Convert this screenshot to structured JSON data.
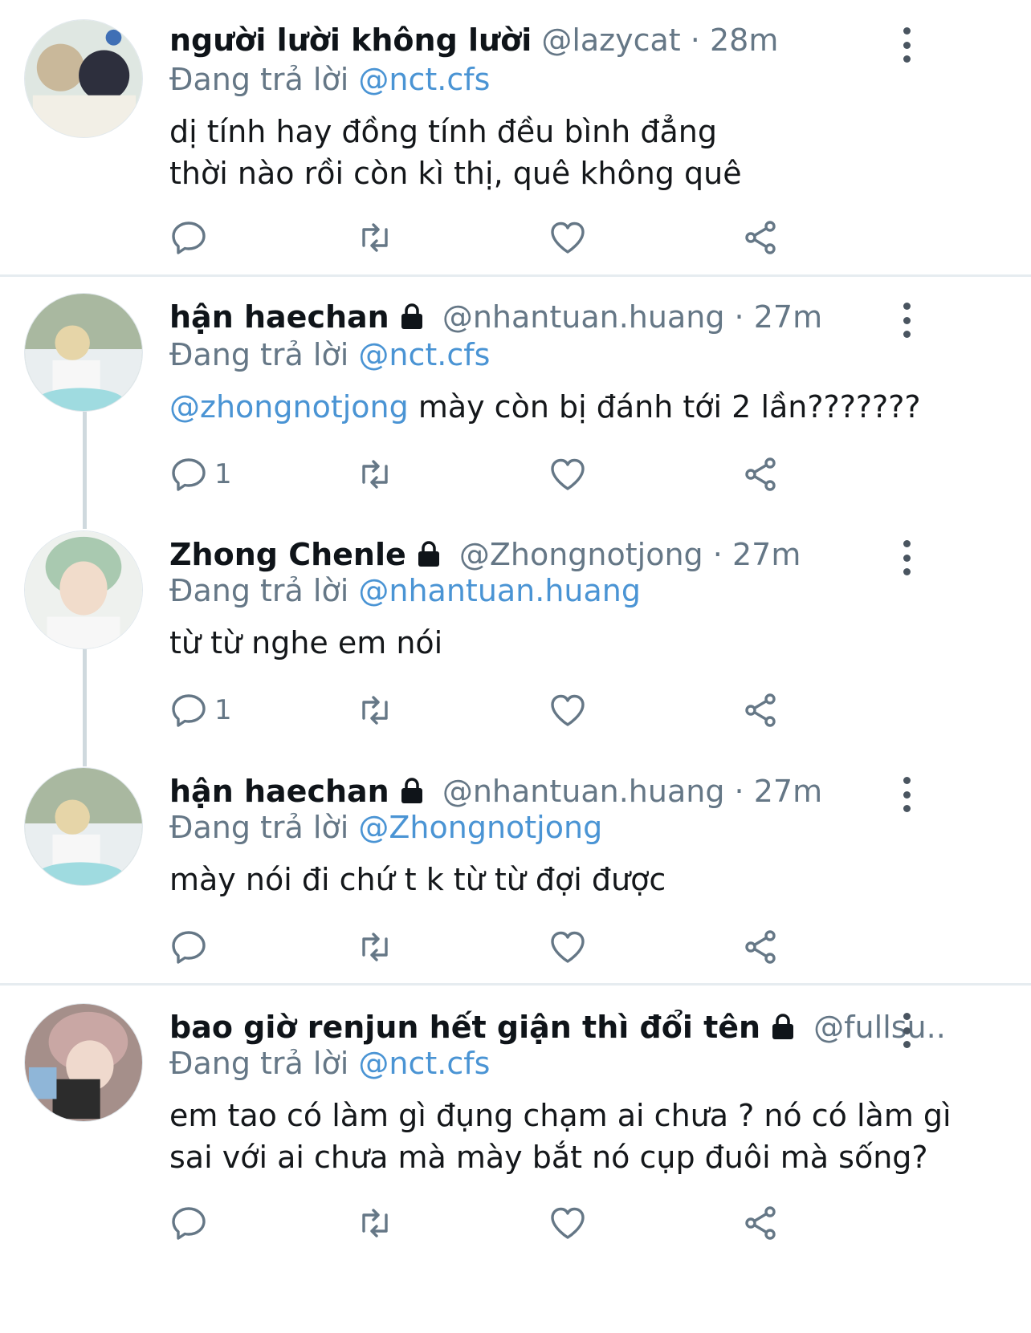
{
  "colors": {
    "accent": "#4a94d4",
    "muted": "#657786",
    "text": "#0f1419",
    "divider": "#e6ecf0"
  },
  "tweets": [
    {
      "name": "người lười không lười",
      "handle": "@lazycat",
      "dot": "·",
      "time": "28m",
      "reply_prefix": "Đang trả lời",
      "reply_to": "@nct.cfs",
      "body_line1": "dị tính hay đồng tính đều bình đẳng",
      "body_line2": "thời nào rồi còn kì thị, quê không quê",
      "reply_count": ""
    },
    {
      "name": "hận haechan",
      "handle": "@nhantuan.huang",
      "dot": "·",
      "time": "27m",
      "reply_prefix": "Đang trả lời",
      "reply_to": "@nct.cfs",
      "body_mention": "@zhongnotjong",
      "body_text": " mày còn bị đánh tới 2 lần???????",
      "reply_count": "1"
    },
    {
      "name": "Zhong Chenle",
      "handle": "@Zhongnotjong",
      "dot": "·",
      "time": "27m",
      "reply_prefix": "Đang trả lời",
      "reply_to": "@nhantuan.huang",
      "body_line1": "từ từ nghe em nói",
      "reply_count": "1"
    },
    {
      "name": "hận haechan",
      "handle": "@nhantuan.huang",
      "dot": "·",
      "time": "27m",
      "reply_prefix": "Đang trả lời",
      "reply_to": "@Zhongnotjong",
      "body_line1": "mày nói đi chứ t k từ từ đợi được",
      "reply_count": ""
    },
    {
      "name": "bao giờ renjun hết giận thì đổi tên",
      "handle": "@fullsu...",
      "reply_prefix": "Đang trả lời",
      "reply_to": "@nct.cfs",
      "body_line1": "em tao có làm gì đụng chạm ai chưa ? nó có làm gì",
      "body_line2": "sai với ai chưa mà mày bắt nó cụp đuôi mà sống?",
      "reply_count": ""
    }
  ]
}
